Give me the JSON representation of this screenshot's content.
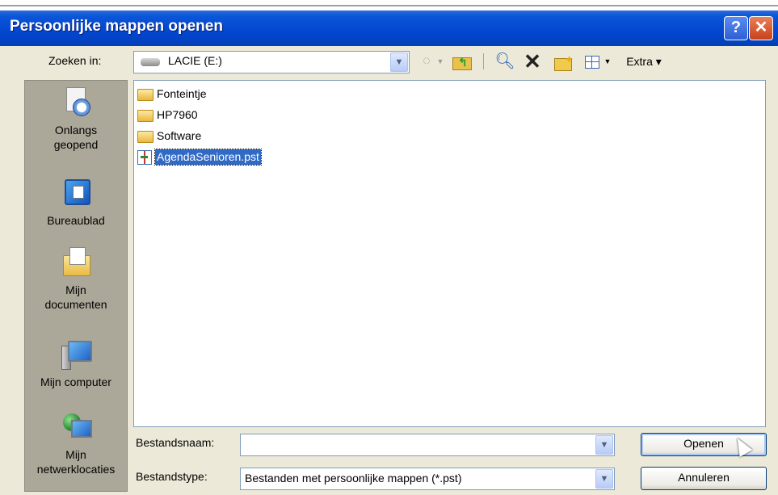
{
  "window": {
    "title": "Persoonlijke mappen openen",
    "help_glyph": "?",
    "close_glyph": "✕"
  },
  "lookin": {
    "label": "Zoeken in:",
    "value": "LACIE (E:)",
    "drive_icon": "drive-icon"
  },
  "toolbar": {
    "back_glyph": "◌",
    "tools_label": "Extra ▾",
    "icons": [
      "back-icon",
      "up-folder-icon",
      "search-web-icon",
      "delete-icon",
      "new-folder-icon",
      "views-icon"
    ]
  },
  "places": [
    {
      "label_line1": "Onlangs",
      "label_line2": "geopend",
      "icon": "recent-documents-icon"
    },
    {
      "label_line1": "Bureaublad",
      "label_line2": "",
      "icon": "desktop-icon"
    },
    {
      "label_line1": "Mijn",
      "label_line2": "documenten",
      "icon": "my-documents-icon"
    },
    {
      "label_line1": "Mijn computer",
      "label_line2": "",
      "icon": "my-computer-icon"
    },
    {
      "label_line1": "Mijn",
      "label_line2": "netwerklocaties",
      "icon": "network-places-icon"
    }
  ],
  "files": [
    {
      "name": "Fonteintje",
      "type": "folder"
    },
    {
      "name": "HP7960",
      "type": "folder"
    },
    {
      "name": "Software",
      "type": "folder"
    },
    {
      "name": "AgendaSenioren.pst",
      "type": "pst",
      "selected": true
    }
  ],
  "filename": {
    "label": "Bestandsnaam:",
    "value": ""
  },
  "filetype": {
    "label": "Bestandstype:",
    "value": "Bestanden met persoonlijke mappen (*.pst)"
  },
  "buttons": {
    "open": "Openen",
    "cancel": "Annuleren"
  },
  "colors": {
    "titlebar": "#0346d0",
    "selection": "#316ac5",
    "dialog_bg": "#ece9d8"
  }
}
